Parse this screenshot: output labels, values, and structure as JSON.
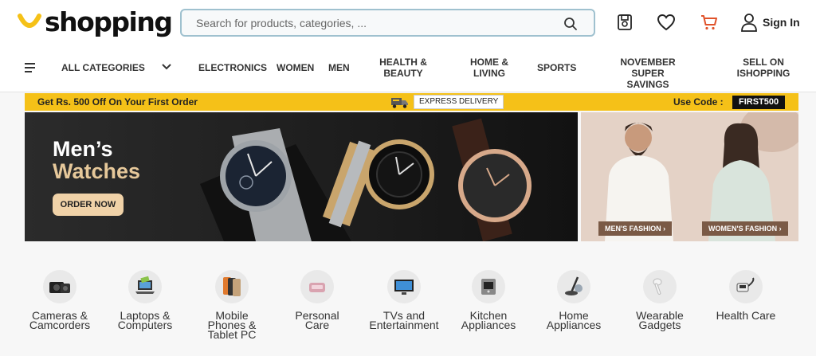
{
  "header": {
    "logo_text": "shopping",
    "search_placeholder": "Search for products, categories, ...",
    "signin_label": "Sign In"
  },
  "nav": {
    "all_categories": "ALL CATEGORIES",
    "items": [
      "ELECTRONICS",
      "WOMEN",
      "MEN",
      "HEALTH &\nBEAUTY",
      "HOME &\nLIVING",
      "SPORTS",
      "NOVEMBER SUPER\nSAVINGS",
      "SELL ON\nISHOPPING"
    ]
  },
  "promo": {
    "left_text": "Get Rs. 500 Off  On Your First Order",
    "express_label": "EXPRESS DELIVERY",
    "use_code_label": "Use Code :",
    "code": "FIRST500"
  },
  "banner": {
    "title_line1": "Men’s",
    "title_line2": "Watches",
    "cta": "ORDER NOW",
    "mens_fashion": "MEN'S FASHION ›",
    "womens_fashion": "WOMEN'S FASHION ›"
  },
  "categories": [
    {
      "label": "Cameras &\nCamcorders",
      "icon": "camera-icon"
    },
    {
      "label": "Laptops &\nComputers",
      "icon": "laptop-icon"
    },
    {
      "label": "Mobile\nPhones &\nTablet PC",
      "icon": "phone-icon"
    },
    {
      "label": "Personal\nCare",
      "icon": "personal-care-icon"
    },
    {
      "label": "TVs and\nEntertainment",
      "icon": "tv-icon"
    },
    {
      "label": "Kitchen\nAppliances",
      "icon": "kitchen-icon"
    },
    {
      "label": "Home\nAppliances",
      "icon": "vacuum-icon"
    },
    {
      "label": "Wearable\nGadgets",
      "icon": "earbud-icon"
    },
    {
      "label": "Health Care",
      "icon": "health-icon"
    }
  ],
  "colors": {
    "brand_yellow": "#f5c118",
    "cart_red": "#e0522a",
    "search_border": "#9fc1cf"
  }
}
